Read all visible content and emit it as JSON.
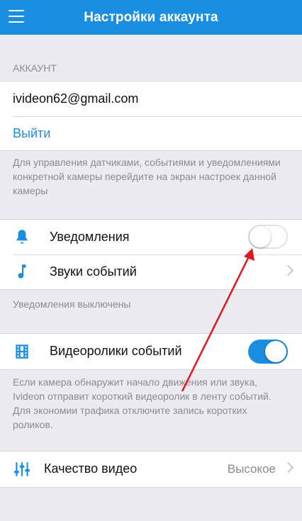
{
  "header": {
    "title": "Настройки аккаунта",
    "menu_icon": "hamburger-menu-icon"
  },
  "account": {
    "section_label": "АККАУНТ",
    "email": "ivideon62@gmail.com",
    "logout_label": "Выйти",
    "note": "Для управления датчиками, событиями и уведомлениями конкретной камеры перейдите на экран настроек данной камеры"
  },
  "notifications": {
    "label": "Уведомления",
    "icon": "bell-icon",
    "enabled": false
  },
  "event_sounds": {
    "label": "Звуки событий",
    "icon": "music-note-icon"
  },
  "notifications_status": "Уведомления выключены",
  "event_videos": {
    "label": "Видеоролики событий",
    "icon": "film-icon",
    "enabled": true,
    "note": "Если камера обнаружит начало движения или звука, Ivideon отправит короткий видеоролик в ленту событий. Для экономии трафика отключите запись коротких роликов."
  },
  "video_quality": {
    "label": "Качество видео",
    "value": "Высокое",
    "icon": "sliders-icon"
  },
  "colors": {
    "accent": "#1a8ee0",
    "annotation_arrow": "#e8141b",
    "background": "#ebebf1"
  }
}
